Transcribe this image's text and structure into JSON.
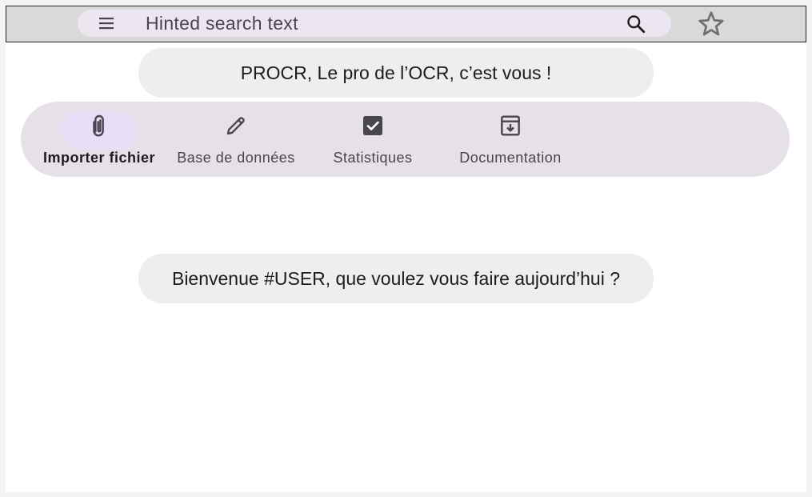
{
  "search": {
    "placeholder": "Hinted search text"
  },
  "header": {
    "title": "PROCR, Le pro de l’OCR, c’est vous !"
  },
  "nav": {
    "items": [
      {
        "label": "Importer fichier",
        "icon": "paperclip-icon",
        "active": true
      },
      {
        "label": "Base de données",
        "icon": "pencil-icon",
        "active": false
      },
      {
        "label": "Statistiques",
        "icon": "checkbox-icon",
        "active": false
      },
      {
        "label": "Documentation",
        "icon": "archive-icon",
        "active": false
      }
    ]
  },
  "main": {
    "welcome": "Bienvenue #USER, que voulez vous faire aujourd’hui ?"
  },
  "colors": {
    "topbar": "#d9d9d9",
    "searchbar": "#ece6f0",
    "navrail": "#e6e0e9",
    "active_indicator": "#e8def8",
    "pill": "#efedee",
    "icon": "#49454f"
  }
}
